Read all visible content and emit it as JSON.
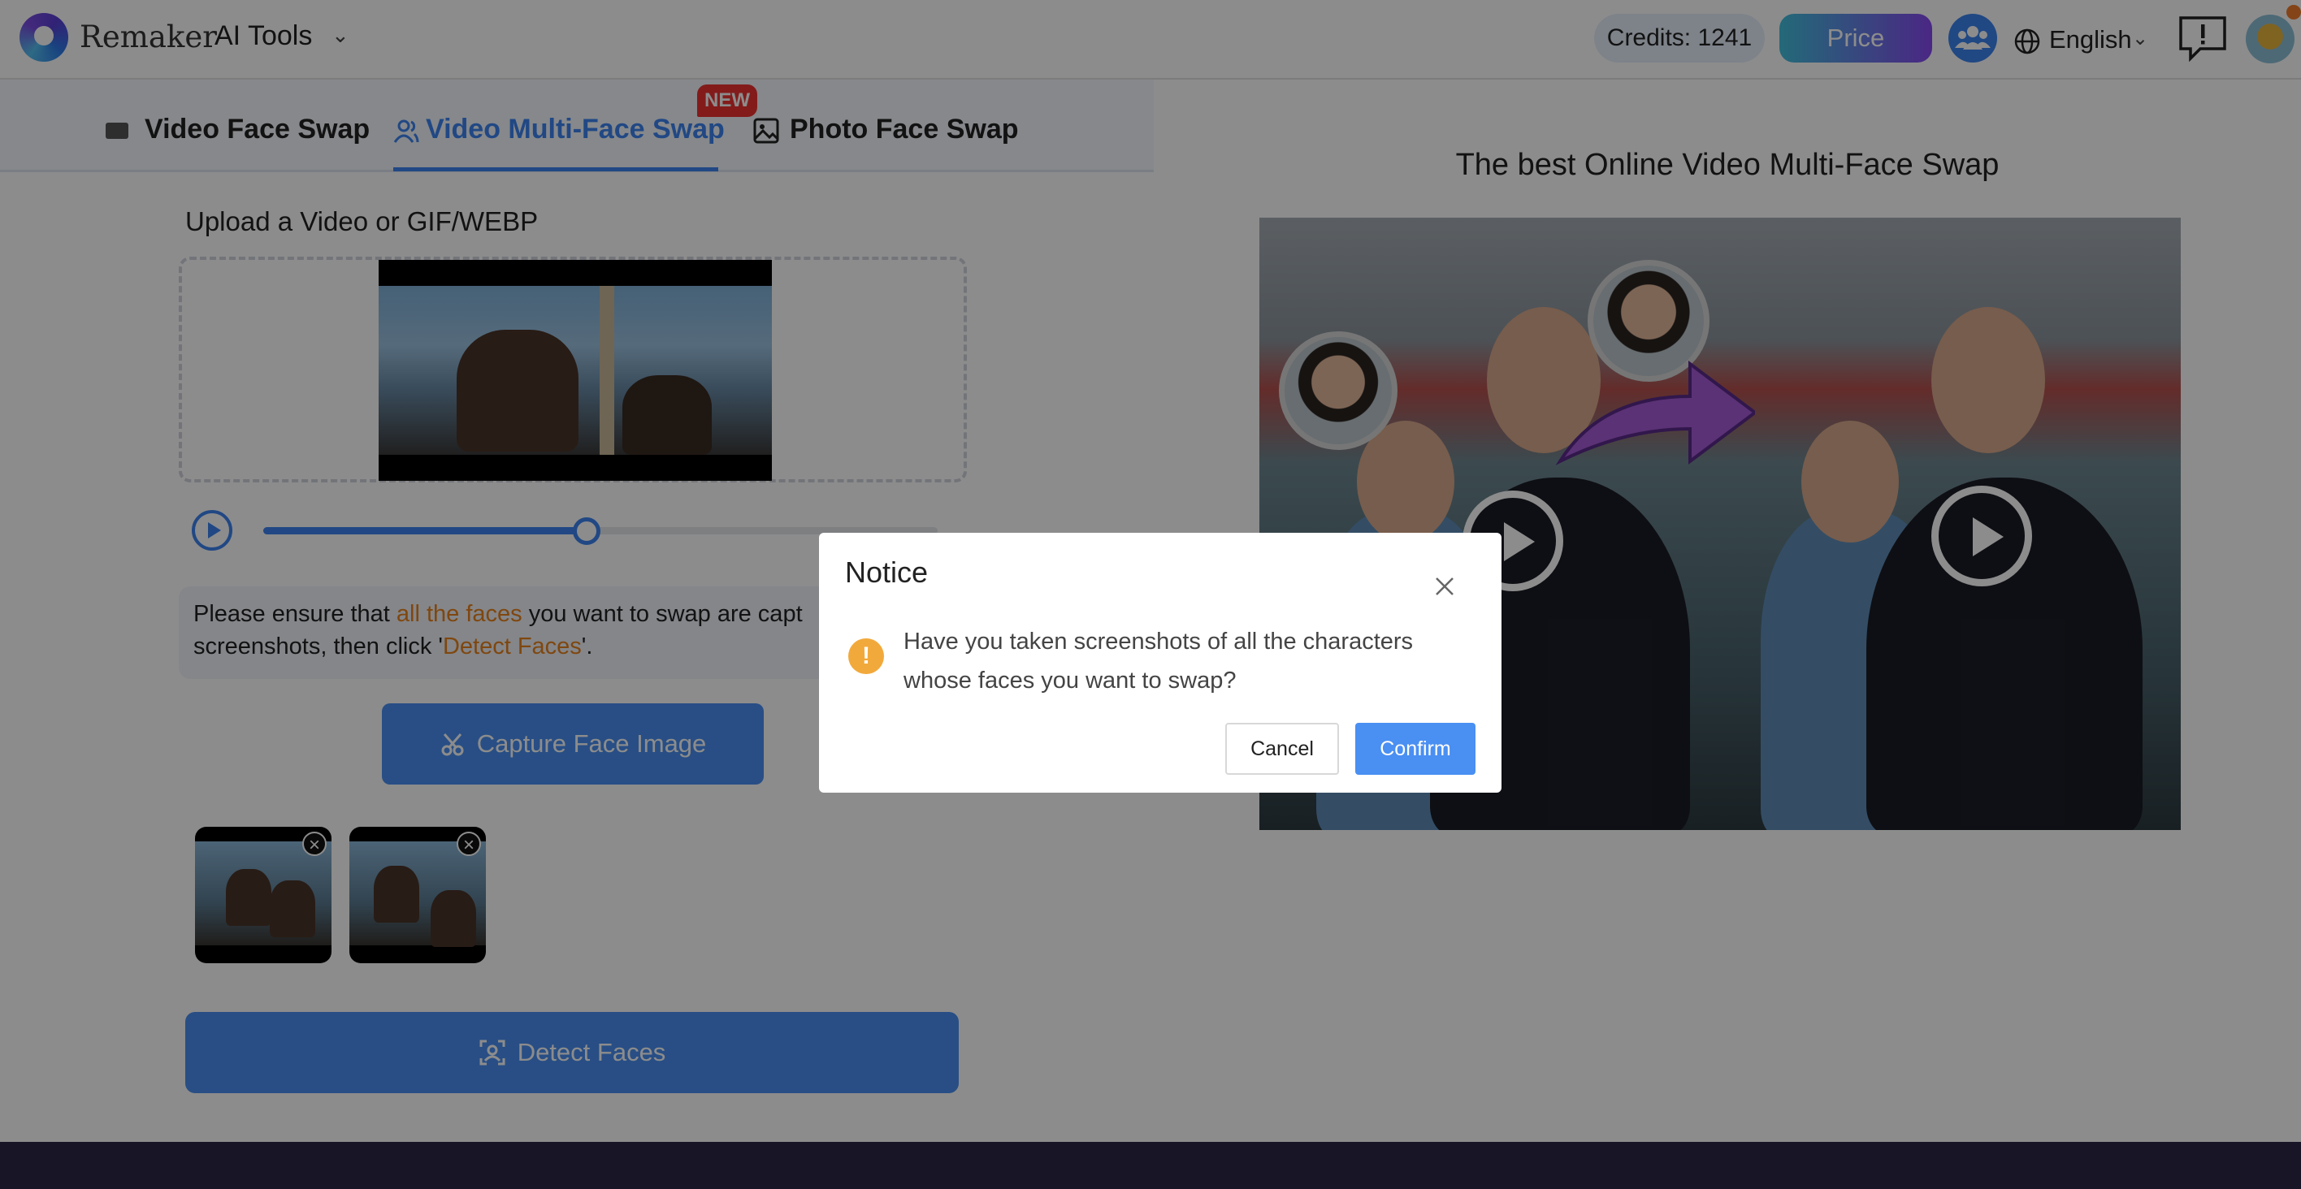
{
  "header": {
    "brand": "Remaker",
    "ai_tools": "AI Tools",
    "credits": "Credits: 1241",
    "price": "Price",
    "language": "English"
  },
  "tabs": [
    {
      "label": "Video Face Swap",
      "icon": "video-camera-icon"
    },
    {
      "label": "Video Multi-Face Swap",
      "icon": "users-icon",
      "badge": "NEW",
      "active": true
    },
    {
      "label": "Photo Face Swap",
      "icon": "image-icon"
    }
  ],
  "upload": {
    "title": "Upload a Video or GIF/WEBP",
    "playback_progress": 0.48
  },
  "notice": {
    "part1": "Please ensure that ",
    "highlight1": "all the faces",
    "part2": " you want to swap are capt",
    "part3": "screenshots, then click '",
    "highlight2": "Detect Faces",
    "part4": "'."
  },
  "buttons": {
    "capture": "Capture Face Image",
    "detect": "Detect Faces"
  },
  "right": {
    "title": "The best Online Video Multi-Face Swap"
  },
  "modal": {
    "title": "Notice",
    "message": "Have you taken screenshots of all the characters whose faces you want to swap?",
    "cancel": "Cancel",
    "confirm": "Confirm"
  },
  "colors": {
    "accent": "#3d84f0",
    "highlight": "#e8821c",
    "badge": "#ee3232",
    "warning": "#f2a93b"
  }
}
